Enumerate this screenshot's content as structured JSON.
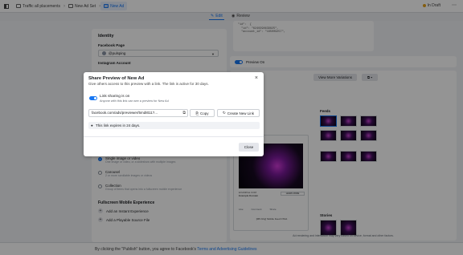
{
  "topbar": {
    "crumbs": [
      {
        "label": "Traffic all placements"
      },
      {
        "label": "New Ad Set"
      },
      {
        "label": "New Ad"
      }
    ],
    "status": "In Draft"
  },
  "modes": {
    "edit": "Edit",
    "review": "Review"
  },
  "json_snippet": "\"id\": \"6240298639825\",\n  \"account_id\": \"185009257\",",
  "json_header": "\"id\":  {",
  "identity": {
    "heading": "Identity",
    "page_label": "Facebook Page",
    "page_value": "@pulsping",
    "instagram_label": "Instagram Account"
  },
  "format": {
    "options": [
      {
        "title": "Single image or video",
        "desc": "One image or video, or a slideshow with multiple images",
        "selected": true
      },
      {
        "title": "Carousel",
        "desc": "2 or more scrollable images or videos",
        "selected": false
      },
      {
        "title": "Collection",
        "desc": "Group of items that opens into a fullscreen mobile experience",
        "selected": false
      }
    ],
    "fullscreen_heading": "Fullscreen Mobile Experience",
    "add_instant": "Add an Instant Experience",
    "add_playable": "Add a Playable Source File"
  },
  "preview": {
    "toggle_label": "Preview On",
    "more_variations": "View More Variations",
    "feeds_label": "Feeds",
    "stories_label": "Stories",
    "learn_more": "LEARN MORE",
    "ad_domain": "EXAMPLE.COM",
    "ad_headline": "Example Domain",
    "reactions": [
      "Like",
      "Comment",
      "Share"
    ],
    "ad_footer_title": "[FB Only] Mobile Feed CTAA",
    "disclaimer": "Ad rendering and interaction may vary based on device, format and other factors."
  },
  "bottombar": {
    "text": "By clicking the \"Publish\" button, you agree to Facebook's",
    "link": "Terms and Advertising Guidelines"
  },
  "modal": {
    "title": "Share Preview of New Ad",
    "subtitle": "Give others access to this preview with a link. The link is active for 30 days.",
    "link_sharing_label": "Link sharing is on",
    "link_sharing_desc": "Anyone with this link can see a preview for New Ad",
    "link_value": "facebook.com/ads/previewer/5md8t11?...",
    "copy_label": "Copy",
    "new_link_label": "Create New Link",
    "expiry_note": "This link expires in 24 days.",
    "close_label": "Close"
  }
}
